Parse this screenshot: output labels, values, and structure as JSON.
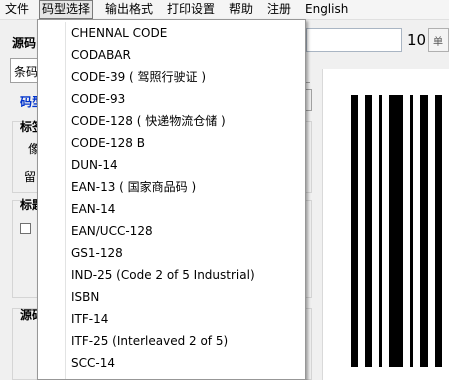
{
  "menubar": {
    "items": [
      "文件",
      "码型选择",
      "输出格式",
      "打印设置",
      "帮助",
      "注册",
      "English"
    ]
  },
  "background": {
    "source_label": "源码",
    "tab_label": "条码",
    "code_link": "码型",
    "group1_label": "标签",
    "group1_text1": "像",
    "group1_text2": "留",
    "group2_label": "标题",
    "group3_label": "源码",
    "size_value": "10",
    "unit_text": "单"
  },
  "dropdown": {
    "items": [
      "CHENNAL CODE",
      "CODABAR",
      "CODE-39 ( 驾照行驶证 )",
      "CODE-93",
      "CODE-128 ( 快递物流仓储 )",
      "CODE-128 B",
      "DUN-14",
      "EAN-13 ( 国家商品码 )",
      "EAN-14",
      "EAN/UCC-128",
      "GS1-128",
      "IND-25 (Code 2 of 5 Industrial)",
      "ISBN",
      "ITF-14",
      "ITF-25 (Interleaved 2 of 5)",
      "SCC-14"
    ]
  },
  "colors": {
    "link_blue": "#0033cc",
    "menu_highlight": "#e6e6e6"
  }
}
